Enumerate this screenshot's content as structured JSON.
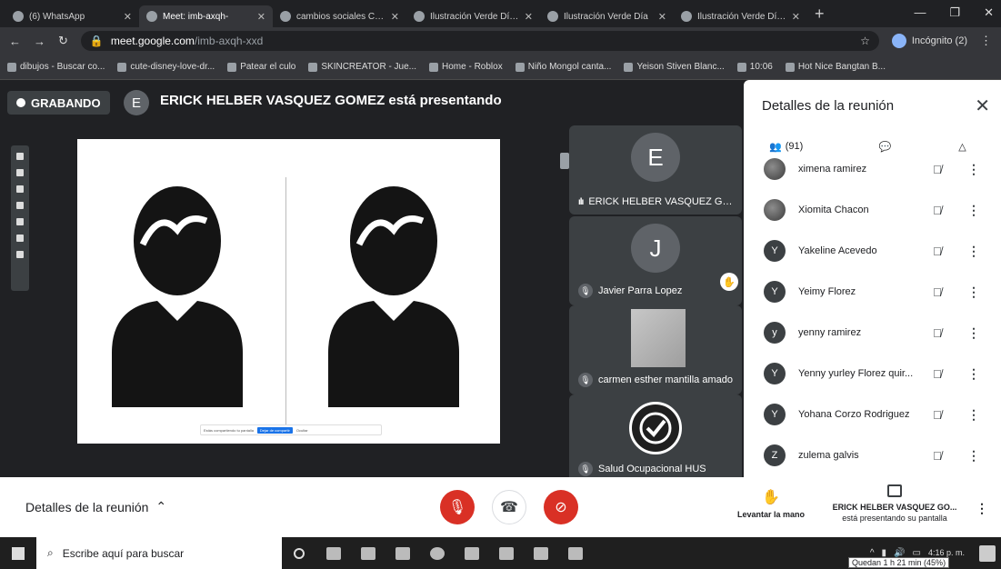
{
  "browser": {
    "tabs": [
      {
        "label": "(6) WhatsApp",
        "active": false
      },
      {
        "label": "Meet: imb-axqh-",
        "active": true
      },
      {
        "label": "cambios sociales Cavi",
        "active": false
      },
      {
        "label": "Ilustración Verde Día c",
        "active": false
      },
      {
        "label": "Ilustración Verde Día",
        "active": false
      },
      {
        "label": "Ilustración Verde Día c",
        "active": false
      }
    ],
    "url_host": "meet.google.com",
    "url_path": "/imb-axqh-xxd",
    "profile_label": "Incógnito (2)",
    "bookmarks": [
      "dibujos - Buscar co...",
      "cute-disney-love-dr...",
      "Patear el culo",
      "SKINCREATOR - Jue...",
      "Home - Roblox",
      "Niño Mongol canta...",
      "Yeison Stiven Blanc...",
      "10:06",
      "Hot Nice Bangtan B..."
    ]
  },
  "meet": {
    "recording_label": "GRABANDO",
    "presenter_initial": "E",
    "presenting_text": "ERICK HELBER VASQUEZ GOMEZ está presentando",
    "share_bar": {
      "text": "Estás compartiendo tu pantalla",
      "stop_label": "Dejar de compartir",
      "hide_label": "Ocultar"
    },
    "tiles": [
      {
        "initial": "E",
        "name": "ERICK HELBER VASQUEZ GO..."
      },
      {
        "initial": "J",
        "name": "Javier Parra Lopez"
      },
      {
        "initial": "",
        "name": "carmen esther mantilla amado"
      },
      {
        "initial": "",
        "name": "Salud Ocupacional HUS"
      }
    ]
  },
  "panel": {
    "title": "Detalles de la reunión",
    "people_count": "(91)",
    "people": [
      {
        "initial": "",
        "name": "ximena ramirez",
        "photo": true
      },
      {
        "initial": "",
        "name": "Xiomita Chacon",
        "photo": true
      },
      {
        "initial": "Y",
        "name": "Yakeline Acevedo",
        "photo": false
      },
      {
        "initial": "Y",
        "name": "Yeimy Florez",
        "photo": false
      },
      {
        "initial": "y",
        "name": "yenny ramirez",
        "photo": false
      },
      {
        "initial": "Y",
        "name": "Yenny yurley Florez quir...",
        "photo": false
      },
      {
        "initial": "Y",
        "name": "Yohana Corzo Rodriguez",
        "photo": false
      },
      {
        "initial": "Z",
        "name": "zulema galvis",
        "photo": false
      }
    ]
  },
  "controls": {
    "details_label": "Detalles de la reunión",
    "raise_hand_label": "Levantar la mano",
    "presenting_name": "ERICK HELBER VASQUEZ GO...",
    "presenting_sub": "está presentando su pantalla"
  },
  "taskbar": {
    "search_placeholder": "Escribe aquí para buscar",
    "time": "4:16 p. m.",
    "battery_tooltip": "Quedan 1 h 21 min (45%)"
  }
}
